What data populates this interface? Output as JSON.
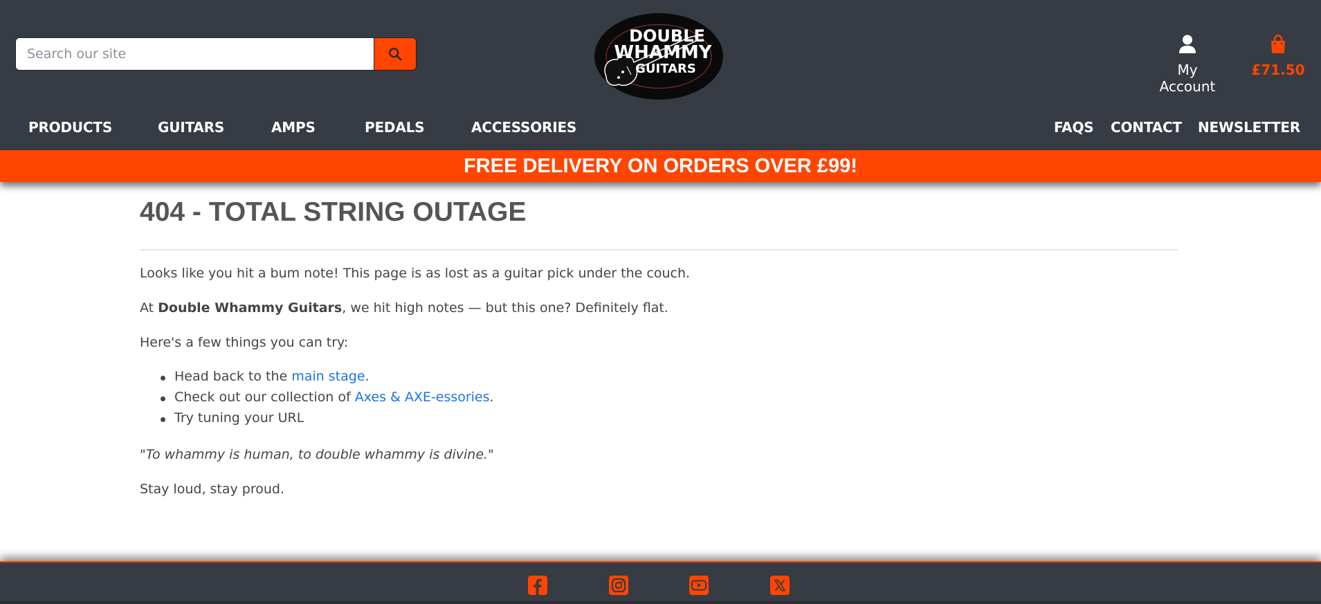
{
  "header": {
    "search": {
      "placeholder": "Search our site",
      "icon": "search-icon"
    },
    "logo": {
      "line1": "DOUBLE",
      "line2": "WHAMMY",
      "line3": "GUITARS"
    },
    "account": {
      "label": "My Account",
      "icon": "user-icon"
    },
    "cart": {
      "total": "£71.50",
      "icon": "shopping-bag-icon"
    }
  },
  "nav": {
    "left": [
      "PRODUCTS",
      "GUITARS",
      "AMPS",
      "PEDALS",
      "ACCESSORIES"
    ],
    "right": [
      "FAQS",
      "CONTACT",
      "NEWSLETTER"
    ]
  },
  "banner": {
    "text": "FREE DELIVERY ON ORDERS OVER £99!"
  },
  "main": {
    "title": "404 - TOTAL STRING OUTAGE",
    "p1": "Looks like you hit a bum note! This page is as lost as a guitar pick under the couch.",
    "p2_prefix": "At ",
    "p2_bold": "Double Whammy Guitars",
    "p2_suffix": ", we hit high notes — but this one? Definitely flat.",
    "p3": "Here's a few things you can try:",
    "tips": [
      {
        "prefix": "Head back to the ",
        "link": "main stage",
        "suffix": "."
      },
      {
        "prefix": "Check out our collection of ",
        "link": "Axes & AXE-essories",
        "suffix": "."
      },
      {
        "prefix": "Try tuning your URL",
        "link": "",
        "suffix": ""
      }
    ],
    "quote": "\"To whammy is human, to double whammy is divine.\"",
    "signoff": "Stay loud, stay proud."
  },
  "footer": {
    "social_icons": [
      "facebook-icon",
      "instagram-icon",
      "youtube-icon",
      "x-twitter-icon"
    ]
  },
  "colors": {
    "header_bg": "#373b44",
    "accent": "#ff4500",
    "link": "#1a73e8",
    "text": "#444444"
  }
}
